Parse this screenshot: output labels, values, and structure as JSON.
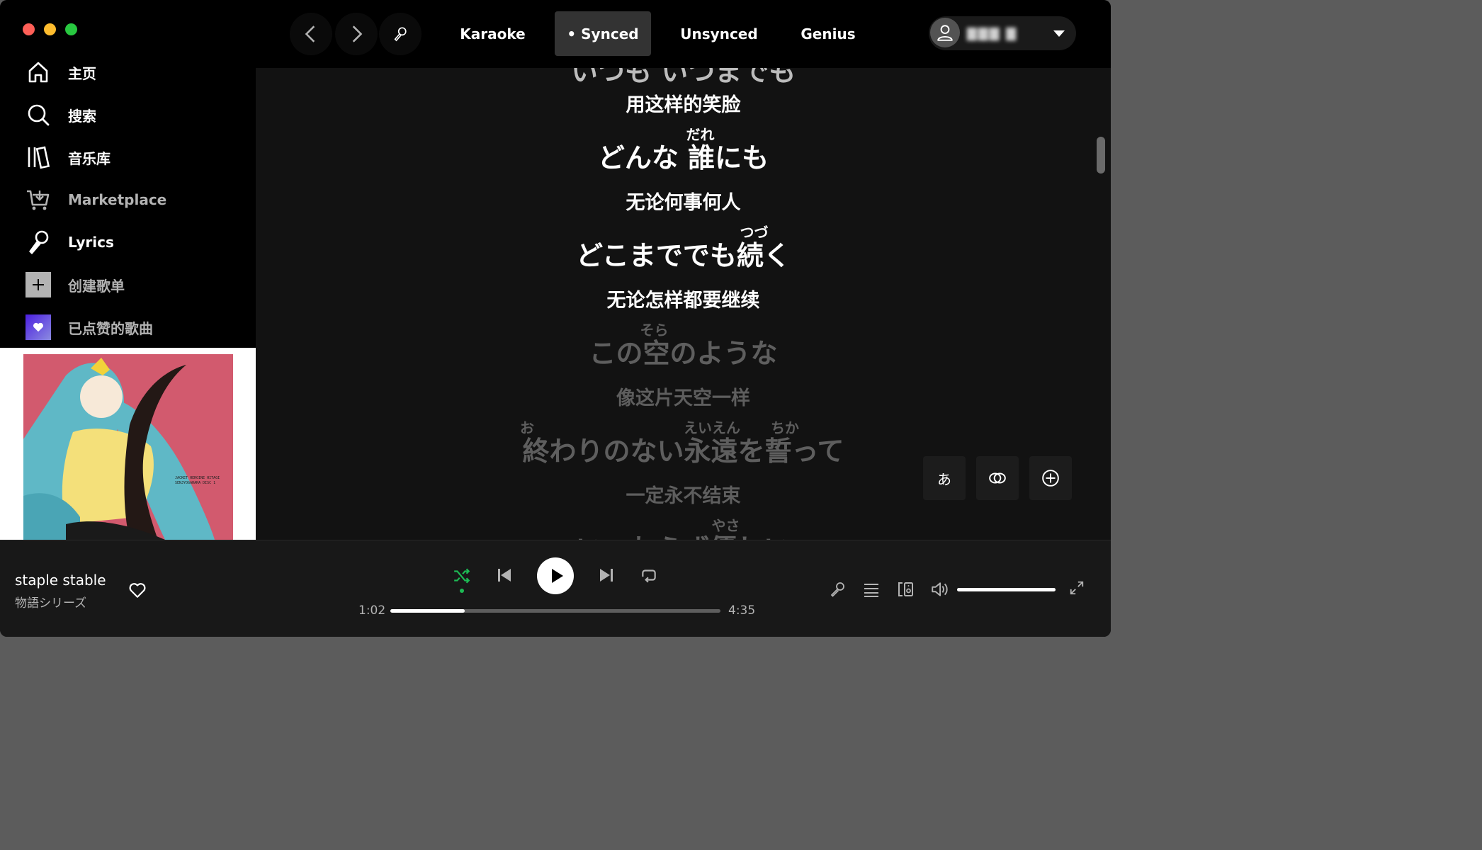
{
  "sidebar": {
    "items": [
      {
        "label": "主页",
        "icon": "home-icon"
      },
      {
        "label": "搜索",
        "icon": "search-icon"
      },
      {
        "label": "音乐库",
        "icon": "library-icon"
      },
      {
        "label": "Marketplace",
        "icon": "cart-download-icon"
      },
      {
        "label": "Lyrics",
        "icon": "microphone-icon"
      },
      {
        "label": "创建歌单",
        "icon": "plus-icon"
      },
      {
        "label": "已点赞的歌曲",
        "icon": "heart-icon"
      }
    ],
    "cover_art": {
      "text": "JACKET HEROINE HITAGI SENJYOGAHARA DISC 1",
      "bg_color": "#d25a6e"
    }
  },
  "topbar": {
    "tabs": [
      {
        "label": "Karaoke"
      },
      {
        "label": "• Synced"
      },
      {
        "label": "Unsynced"
      },
      {
        "label": "Genius"
      }
    ],
    "active_tab": "• Synced",
    "user_name": "▇▇▇ ▇"
  },
  "lyrics": {
    "lines": [
      {
        "text": "いつも いつまでも",
        "lang": "ja",
        "state": "cut-top"
      },
      {
        "text": "用这样的笑脸",
        "lang": "zh",
        "state": "active"
      },
      {
        "text": "どんな 誰にも",
        "lang": "ja",
        "state": "active",
        "ruby": [
          {
            "text": "だれ",
            "over": "誰"
          }
        ]
      },
      {
        "text": "无论何事何人",
        "lang": "zh",
        "state": "active"
      },
      {
        "text": "どこまででも続く",
        "lang": "ja",
        "state": "active",
        "ruby": [
          {
            "text": "つづ",
            "over": "続"
          }
        ]
      },
      {
        "text": "无论怎样都要继续",
        "lang": "zh",
        "state": "active"
      },
      {
        "text": "この空のような",
        "lang": "ja",
        "state": "upcoming",
        "ruby": [
          {
            "text": "そら",
            "over": "空"
          }
        ]
      },
      {
        "text": "像这片天空一样",
        "lang": "zh",
        "state": "upcoming"
      },
      {
        "text": "終わりのない永遠を誓って",
        "lang": "ja",
        "state": "upcoming",
        "ruby": [
          {
            "text": "お",
            "over": "終"
          },
          {
            "text": "えいえん",
            "over": "永遠"
          },
          {
            "text": "ちか",
            "over": "誓"
          }
        ]
      },
      {
        "text": "一定永不结束",
        "lang": "zh",
        "state": "upcoming"
      },
      {
        "text": "いつわらず優しい",
        "lang": "ja",
        "state": "cut-bottom",
        "ruby": [
          {
            "text": "やさ",
            "over": "優"
          }
        ]
      }
    ],
    "controls": {
      "kana": "あ",
      "translate_icon": "translate-icon",
      "add_icon": "plus-circle-icon"
    }
  },
  "player": {
    "title": "staple stable",
    "artist": "物語シリーズ",
    "elapsed": "1:02",
    "duration": "4:35",
    "progress": 0.225,
    "volume": 1.0,
    "accent_color": "#1db954"
  }
}
